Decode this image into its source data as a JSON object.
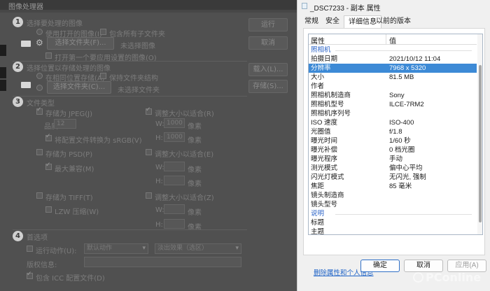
{
  "processor": {
    "title": "图像处理器",
    "sections": [
      {
        "number": "1",
        "heading": "选择要处理的图像"
      },
      {
        "number": "2",
        "heading": "选择位置以存储处理的图像"
      },
      {
        "number": "3",
        "heading": "文件类型"
      },
      {
        "number": "4",
        "heading": "首选项"
      }
    ],
    "s1": {
      "use_open": "使用打开的图像(I)",
      "include_sub": "包含所有子文件夹",
      "select_folder_btn": "选择文件夹(F)...",
      "no_image": "未选择图像",
      "open_first": "打开第一个要应用设置的图像(O)"
    },
    "s2": {
      "same_location": "在相同位置存储(A)",
      "keep_structure": "保持文件夹结构",
      "select_folder_btn": "选择文件夹(C)...",
      "no_folder": "未选择文件夹"
    },
    "s3": {
      "save_jpeg": "存储为 JPEG(J)",
      "resize": "调整大小以适合(R)",
      "quality_label": "品质:",
      "quality_value": "12",
      "w_label": "W:",
      "h_label": "H:",
      "w_value": "1000",
      "h_value": "1000",
      "px": "像素",
      "convert_srgb": "将配置文件转换为 sRGB(V)",
      "save_psd": "存储为 PSD(P)",
      "resize_psd": "调整大小以适合(E)",
      "max_compat": "最大兼容(M)",
      "save_tiff": "存储为 TIFF(T)",
      "resize_tiff": "调整大小以适合(Z)",
      "lzw": "LZW 压缩(W)"
    },
    "s4": {
      "run_action": "运行动作(U):",
      "action_set": "默认动作",
      "action": "淡出效果（选区）",
      "copyright": "版权信息:",
      "include_icc": "包含 ICC 配置文件(D)"
    },
    "buttons": {
      "run": "运行",
      "cancel": "取消",
      "load": "载入(L)...",
      "save": "存储(S)..."
    }
  },
  "props": {
    "window_title": "_DSC7233 - 副本 属性",
    "tabs": [
      "常规",
      "安全",
      "详细信息",
      "以前的版本"
    ],
    "active_tab_index": 2,
    "grid": {
      "col_property": "属性",
      "col_value": "值",
      "rows": [
        {
          "type": "group",
          "key": "照相机"
        },
        {
          "key": "拍摄日期",
          "value": "2021/10/12 11:04"
        },
        {
          "key": "分辨率",
          "value": "7968 x 5320",
          "selected": true
        },
        {
          "key": "大小",
          "value": "81.5 MB"
        },
        {
          "key": "作者",
          "value": ""
        },
        {
          "key": "照相机制造商",
          "value": "Sony"
        },
        {
          "key": "照相机型号",
          "value": "ILCE-7RM2"
        },
        {
          "key": "照相机序列号",
          "value": ""
        },
        {
          "key": "ISO 速度",
          "value": "ISO-400"
        },
        {
          "key": "光圈值",
          "value": "f/1.8"
        },
        {
          "key": "曝光时间",
          "value": "1/60 秒"
        },
        {
          "key": "曝光补偿",
          "value": "0 档光圈"
        },
        {
          "key": "曝光程序",
          "value": "手动"
        },
        {
          "key": "测光模式",
          "value": "偏中心平均"
        },
        {
          "key": "闪光灯模式",
          "value": "无闪光, 强制"
        },
        {
          "key": "焦距",
          "value": "85 毫米"
        },
        {
          "key": "镜头制造商",
          "value": ""
        },
        {
          "key": "镜头型号",
          "value": ""
        },
        {
          "type": "group",
          "key": "说明"
        },
        {
          "key": "标题",
          "value": ""
        },
        {
          "key": "主题",
          "value": ""
        }
      ]
    },
    "remove_link": "删除属性和个人信息",
    "ok": "确定",
    "cancel": "取消",
    "apply": "应用(A)"
  },
  "watermark": "PConline"
}
